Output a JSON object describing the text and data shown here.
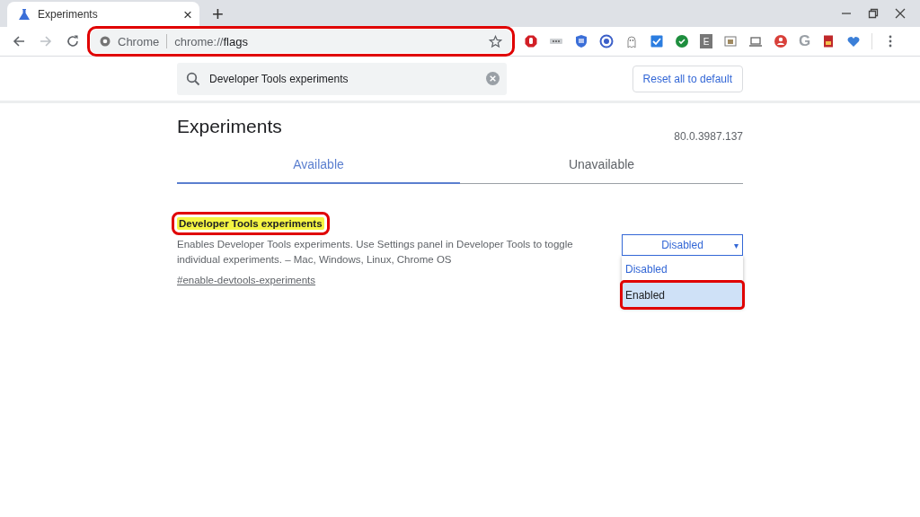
{
  "tab": {
    "title": "Experiments",
    "close": "×",
    "new_tab": "+"
  },
  "address_bar": {
    "site": "Chrome",
    "url_prefix": "chrome://",
    "url_host": "flags",
    "highlighted": true
  },
  "extensions": [
    {
      "kind": "hand"
    },
    {
      "kind": "dots"
    },
    {
      "kind": "shield"
    },
    {
      "kind": "ring"
    },
    {
      "kind": "ghost"
    },
    {
      "kind": "check"
    },
    {
      "kind": "tick"
    },
    {
      "kind": "letter",
      "text": "E"
    },
    {
      "kind": "reader"
    },
    {
      "kind": "laptop"
    },
    {
      "kind": "person"
    },
    {
      "kind": "letter-plain",
      "text": "G"
    },
    {
      "kind": "card"
    },
    {
      "kind": "heart"
    }
  ],
  "search": {
    "value": "Developer Tools experiments"
  },
  "reset_button": "Reset all to default",
  "title": "Experiments",
  "version": "80.0.3987.137",
  "tabs": [
    {
      "label": "Available",
      "selected": true
    },
    {
      "label": "Unavailable",
      "selected": false
    }
  ],
  "flag": {
    "title": "Developer Tools experiments",
    "highlighted": true,
    "description": "Enables Developer Tools experiments. Use Settings panel in Developer Tools to toggle individual experiments. – Mac, Windows, Linux, Chrome OS",
    "link": "#enable-devtools-experiments",
    "dropdown": {
      "value": "Disabled",
      "arrow": "▾",
      "expanded": true,
      "options": [
        {
          "label": "Disabled",
          "selected": true,
          "hovered": false,
          "highlighted": false
        },
        {
          "label": "Enabled",
          "selected": false,
          "hovered": true,
          "highlighted": true
        }
      ]
    }
  }
}
